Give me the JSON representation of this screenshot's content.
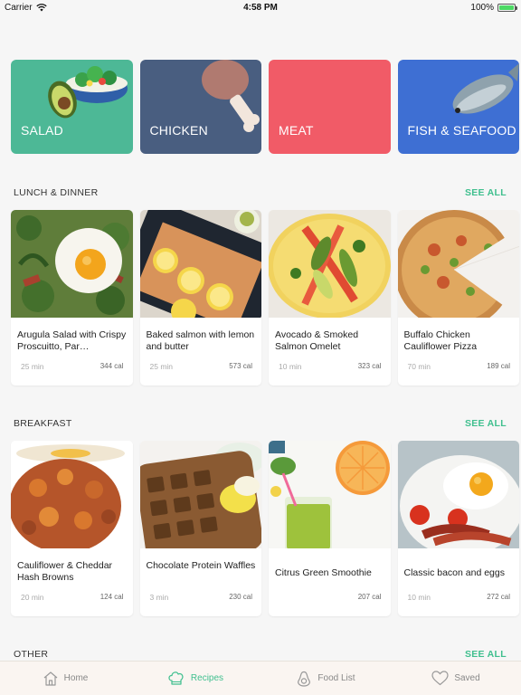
{
  "status": {
    "carrier": "Carrier",
    "time": "4:58 PM",
    "battery": "100%",
    "battery_level": 1.0
  },
  "categories": [
    {
      "label": "SALAD",
      "color": "#4db896",
      "icon": "salad-icon"
    },
    {
      "label": "CHICKEN",
      "color": "#495e80",
      "icon": "chicken-leg-icon"
    },
    {
      "label": "MEAT",
      "color": "#f15b67",
      "icon": "meat-icon"
    },
    {
      "label": "FISH & SEAFOOD",
      "color": "#3e6fd3",
      "icon": "fish-icon"
    }
  ],
  "sections": [
    {
      "title": "LUNCH & DINNER",
      "see_all": "SEE ALL",
      "recipes": [
        {
          "title": "Arugula Salad with Crispy Proscuitto, Par…",
          "time": "25 min",
          "cal": "344 cal"
        },
        {
          "title": "Baked salmon with lemon and butter",
          "time": "25 min",
          "cal": "573 cal"
        },
        {
          "title": "Avocado & Smoked Salmon Omelet",
          "time": "10 min",
          "cal": "323 cal"
        },
        {
          "title": "Buffalo Chicken Cauliflower Pizza",
          "time": "70 min",
          "cal": "189 cal"
        }
      ]
    },
    {
      "title": "BREAKFAST",
      "see_all": "SEE ALL",
      "recipes": [
        {
          "title": "Cauliflower & Cheddar Hash Browns",
          "time": "20 min",
          "cal": "124 cal"
        },
        {
          "title": "Chocolate Protein Waffles",
          "time": "3 min",
          "cal": "230 cal"
        },
        {
          "title": "Citrus Green Smoothie",
          "time": "",
          "cal": "207 cal"
        },
        {
          "title": "Classic bacon and eggs",
          "time": "10 min",
          "cal": "272 cal"
        }
      ]
    },
    {
      "title": "OTHER",
      "see_all": "SEE ALL"
    }
  ],
  "tabs": [
    {
      "label": "Home",
      "icon": "home-icon",
      "active": false
    },
    {
      "label": "Recipes",
      "icon": "chef-hat-icon",
      "active": true
    },
    {
      "label": "Food List",
      "icon": "avocado-icon",
      "active": false
    },
    {
      "label": "Saved",
      "icon": "heart-icon",
      "active": false
    }
  ],
  "accent": "#3fbf8e"
}
